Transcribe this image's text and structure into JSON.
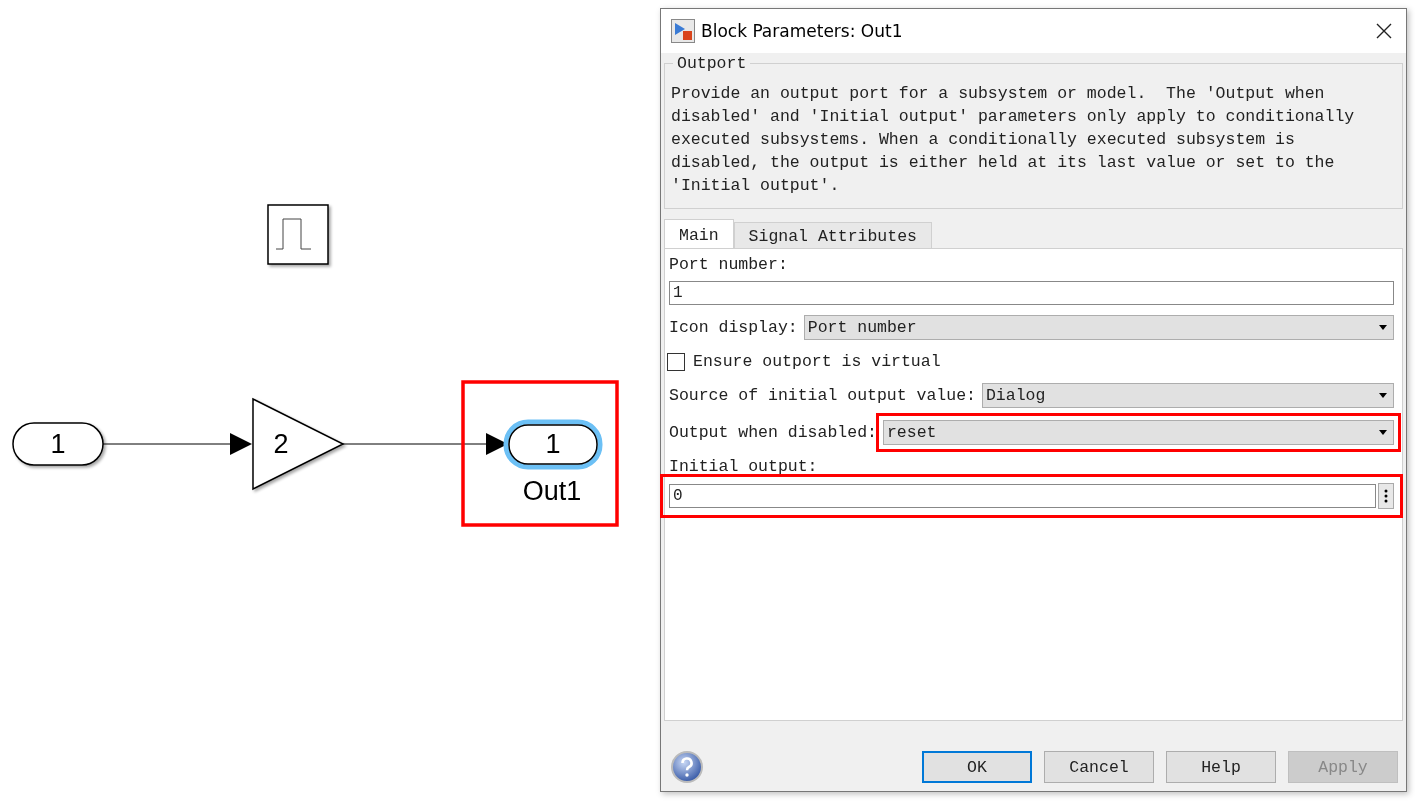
{
  "canvas": {
    "blocks": [
      {
        "kind": "pulse"
      },
      {
        "kind": "inport",
        "label": "1"
      },
      {
        "kind": "gain",
        "label": "2"
      },
      {
        "kind": "outport",
        "label": "1",
        "name": "Out1",
        "selected": true,
        "highlighted": true
      }
    ]
  },
  "dialog": {
    "title": "Block Parameters: Out1",
    "group": "Outport",
    "description": "Provide an output port for a subsystem or model.  The 'Output when disabled' and 'Initial output' parameters only apply to conditionally executed subsystems. When a conditionally executed subsystem is disabled, the output is either held at its last value or set to the 'Initial output'.",
    "tabs": [
      {
        "label": "Main",
        "selected": true
      },
      {
        "label": "Signal Attributes",
        "selected": false
      }
    ],
    "params": [
      {
        "kind": "text",
        "label": "Port number:",
        "value": "1"
      },
      {
        "kind": "select",
        "label": "Icon display:",
        "value": "Port number"
      },
      {
        "kind": "checkbox",
        "label": "Ensure outport is virtual",
        "checked": false
      },
      {
        "kind": "select",
        "label": "Source of initial output value:",
        "value": "Dialog"
      },
      {
        "kind": "select",
        "label": "Output when disabled:",
        "value": "reset",
        "highlighted": true
      },
      {
        "kind": "expression",
        "label": "Initial output:",
        "value": "0",
        "highlighted": true
      }
    ],
    "buttons": [
      {
        "label": "OK",
        "focused": true,
        "disabled": false
      },
      {
        "label": "Cancel",
        "focused": false,
        "disabled": false
      },
      {
        "label": "Help",
        "focused": false,
        "disabled": false
      },
      {
        "label": "Apply",
        "focused": false,
        "disabled": true
      }
    ]
  }
}
